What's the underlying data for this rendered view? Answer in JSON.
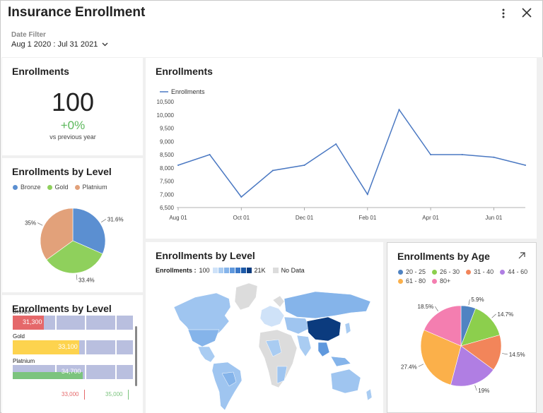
{
  "header": {
    "title": "Insurance Enrollment",
    "date_filter_label": "Date Filter",
    "date_filter_value": "Aug 1 2020 : Jul 31 2021"
  },
  "kpi": {
    "title": "Enrollments",
    "value": "100",
    "delta": "+0%",
    "sub": "vs previous year"
  },
  "pie_level": {
    "title": "Enrollments by Level",
    "legend": [
      {
        "name": "Bronze",
        "color": "#5b8fd1"
      },
      {
        "name": "Gold",
        "color": "#8fd05c"
      },
      {
        "name": "Platnium",
        "color": "#e2a17a"
      }
    ]
  },
  "bar_level": {
    "title": "Enrollments by Level",
    "rows": [
      {
        "label": "Bronze",
        "value": "31,300"
      },
      {
        "label": "Gold",
        "value": "33,100"
      },
      {
        "label": "Platnium",
        "value": "34,700"
      }
    ],
    "targets": [
      "33,000",
      "35,000"
    ]
  },
  "line_card": {
    "title": "Enrollments",
    "legend": "Enrollments"
  },
  "map_card": {
    "title": "Enrollments by Level",
    "legend_label": "Enrollments :",
    "min": "100",
    "max": "21K",
    "no_data": "No Data"
  },
  "age_card": {
    "title": "Enrollments by Age",
    "legend": [
      {
        "name": "20 - 25",
        "color": "#4f83c2"
      },
      {
        "name": "26 - 30",
        "color": "#8ccf4d"
      },
      {
        "name": "31 - 40",
        "color": "#f2855a"
      },
      {
        "name": "44 - 60",
        "color": "#b07ee3"
      },
      {
        "name": "61 - 80",
        "color": "#fbb04a"
      },
      {
        "name": "80+",
        "color": "#f47eb0"
      }
    ]
  },
  "chart_data": [
    {
      "type": "line",
      "title": "Enrollments",
      "x": [
        "Aug 01",
        "Sep 01",
        "Oct 01",
        "Nov 01",
        "Dec 01",
        "Jan 01",
        "Feb 01",
        "Mar 01",
        "Apr 01",
        "May 01",
        "Jun 01",
        "Jul 01"
      ],
      "x_tick_labels": [
        "Aug 01",
        "Oct 01",
        "Dec 01",
        "Feb 01",
        "Apr 01",
        "Jun 01"
      ],
      "series": [
        {
          "name": "Enrollments",
          "values": [
            8100,
            8500,
            6900,
            7900,
            8100,
            8900,
            7000,
            10200,
            8500,
            8500,
            8400,
            8100
          ]
        }
      ],
      "ylim": [
        6500,
        10500
      ],
      "y_ticks": [
        "6,500",
        "7,000",
        "7,500",
        "8,000",
        "8,500",
        "9,000",
        "9,500",
        "10,000",
        "10,500"
      ],
      "grid": false,
      "legend": "top-left",
      "color": "#4a78c2"
    },
    {
      "type": "pie",
      "title": "Enrollments by Level",
      "categories": [
        "Bronze",
        "Gold",
        "Platnium"
      ],
      "values": [
        31.6,
        33.4,
        35.0
      ],
      "labels": [
        "31.6%",
        "33.4%",
        "35%"
      ]
    },
    {
      "type": "bar",
      "title": "Enrollments by Level",
      "categories": [
        "Bronze",
        "Gold",
        "Platnium"
      ],
      "values": [
        31300,
        33100,
        34700
      ],
      "targets": [
        33000,
        35000
      ],
      "colors": [
        "#e5686a",
        "#fdd34e",
        "#7cc47e"
      ]
    },
    {
      "type": "pie",
      "title": "Enrollments by Age",
      "categories": [
        "20 - 25",
        "26 - 30",
        "31 - 40",
        "44 - 60",
        "61 - 80",
        "80+"
      ],
      "values": [
        5.9,
        14.7,
        14.5,
        19.0,
        27.4,
        18.5
      ],
      "labels": [
        "5.9%",
        "14.7%",
        "14.5%",
        "19%",
        "27.4%",
        "18.5%"
      ]
    }
  ]
}
